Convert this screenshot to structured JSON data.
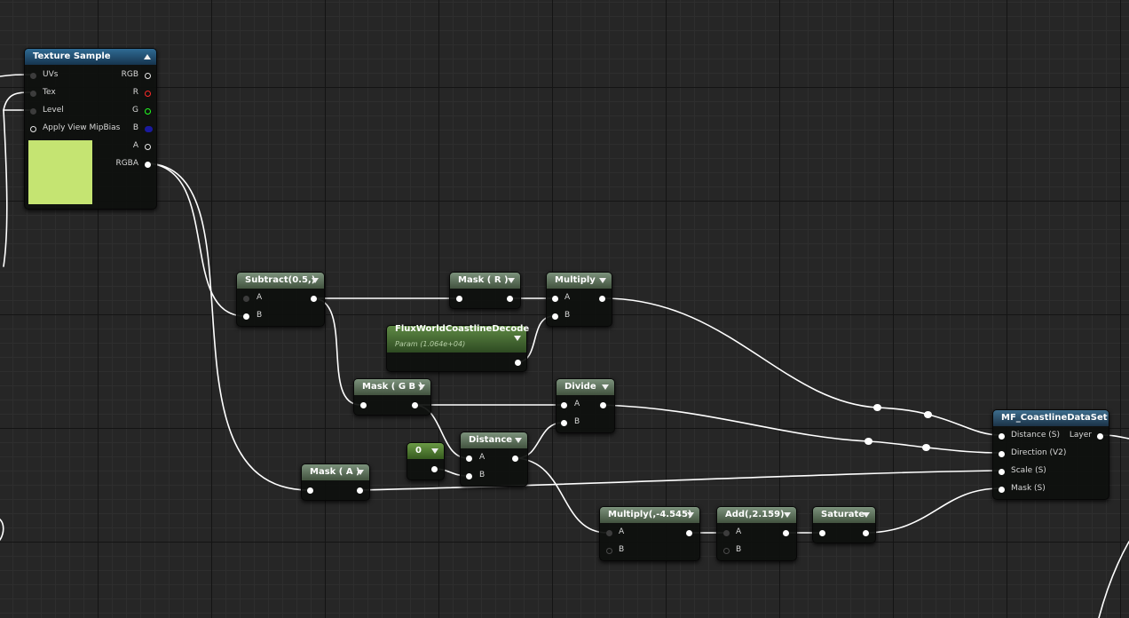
{
  "texture_sample": {
    "title": "Texture Sample",
    "inputs": [
      "UVs",
      "Tex",
      "Level",
      "Apply View MipBias"
    ],
    "outputs": [
      "RGB",
      "R",
      "G",
      "B",
      "A",
      "RGBA"
    ],
    "preview_color": "#c5e472"
  },
  "subtract": {
    "title": "Subtract(0.5,)",
    "pins": [
      "A",
      "B"
    ]
  },
  "mask_r": {
    "title": "Mask ( R )"
  },
  "multiply": {
    "title": "Multiply",
    "pins": [
      "A",
      "B"
    ]
  },
  "param": {
    "title": "FluxWorldCoastlineDecode",
    "subtitle": "Param (1.064e+04)"
  },
  "mask_gb": {
    "title": "Mask ( G B )"
  },
  "divide": {
    "title": "Divide",
    "pins": [
      "A",
      "B"
    ]
  },
  "constant": {
    "title": "0"
  },
  "distance": {
    "title": "Distance",
    "pins": [
      "A",
      "B"
    ]
  },
  "mask_a": {
    "title": "Mask ( A )"
  },
  "multiply2": {
    "title": "Multiply(,-4.545)",
    "pins": [
      "A",
      "B"
    ]
  },
  "add": {
    "title": "Add(,2.159)",
    "pins": [
      "A",
      "B"
    ]
  },
  "saturate": {
    "title": "Saturate"
  },
  "function_node": {
    "title": "MF_CoastlineDataSet",
    "inputs": [
      "Distance (S)",
      "Direction (V2)",
      "Scale (S)",
      "Mask (S)"
    ],
    "output": "Layer"
  },
  "icons": [
    "collapse-arrow-icon",
    "expand-arrow-icon"
  ],
  "colors": {
    "wire": "#ffffff",
    "grid_major": "#141414",
    "grid_minor": "#2e2e2e"
  }
}
